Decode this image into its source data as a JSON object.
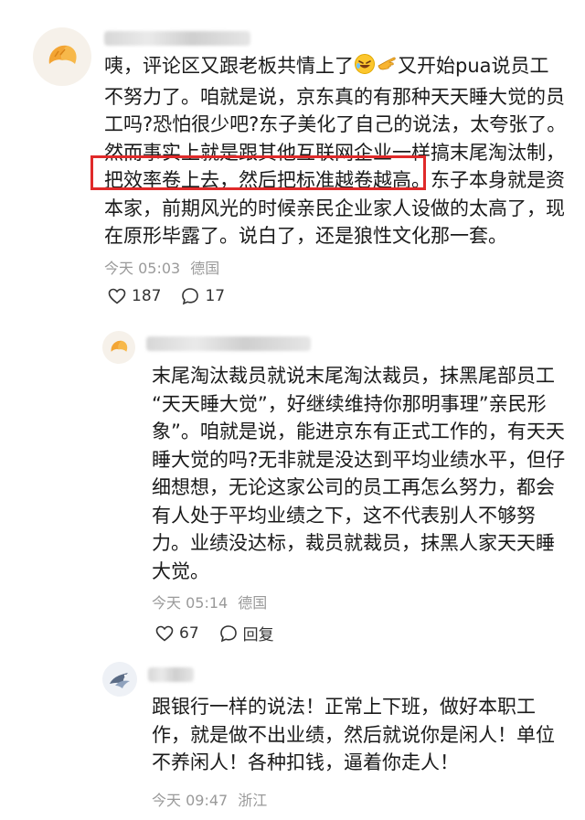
{
  "comments": [
    {
      "avatar_icon": "croissant-icon",
      "text_parts": {
        "before_emoji": "咦，评论区又跟老板共情上了",
        "emoji_1": "rolling-laughing-emoji",
        "emoji_2": "pointing-hand-emoji",
        "after_emoji": "又开始pua说员工",
        "rest": "不努力了。咱就是说，京东真的有那种天天睡大觉的员\n工吗?恐怕很少吧?东子美化了自己的说法，太夸张了。\n然而事实上就是跟其他互联网企业一样搞末尾淘汰制，\n把效率卷上去，然后把标准越卷越高。东子本身就是资\n本家，前期风光的时候亲民企业家人设做的太高了，现\n在原形毕露了。说白了，还是狼性文化那一套。"
      },
      "time": "今天 05:03",
      "location": "德国",
      "likes": "187",
      "replies": "17"
    },
    {
      "avatar_icon": "croissant-icon",
      "text": "末尾淘汰裁员就说末尾淘汰裁员，抹黑尾部员工\n“天天睡大觉”，好继续维持你那明事理”亲民形\n象”。咱就是说，能进京东有正式工作的，有天天\n睡大觉的吗?无非就是没达到平均业绩水平，但仔\n细想想，无论这家公司的员工再怎么努力，都会\n有人处于平均业绩之下，这不代表别人不够努\n力。业绩没达标，裁员就裁员，抹黑人家天天睡\n大觉。",
      "time": "今天 05:14",
      "location": "德国",
      "likes": "67",
      "reply_label": "回复"
    },
    {
      "avatar_icon": "bird-icon",
      "text": "跟银行一样的说法！正常上下班，做好本职工\n作，就是做不出业绩，然后就说你是闲人！单位\n不养闲人！各种扣钱，逼着你走人！",
      "time": "今天 09:47",
      "location": "浙江"
    }
  ],
  "colors": {
    "highlight": "#e02a2a",
    "meta_text": "#9a9a9a",
    "body_text": "#1a1a1a"
  }
}
